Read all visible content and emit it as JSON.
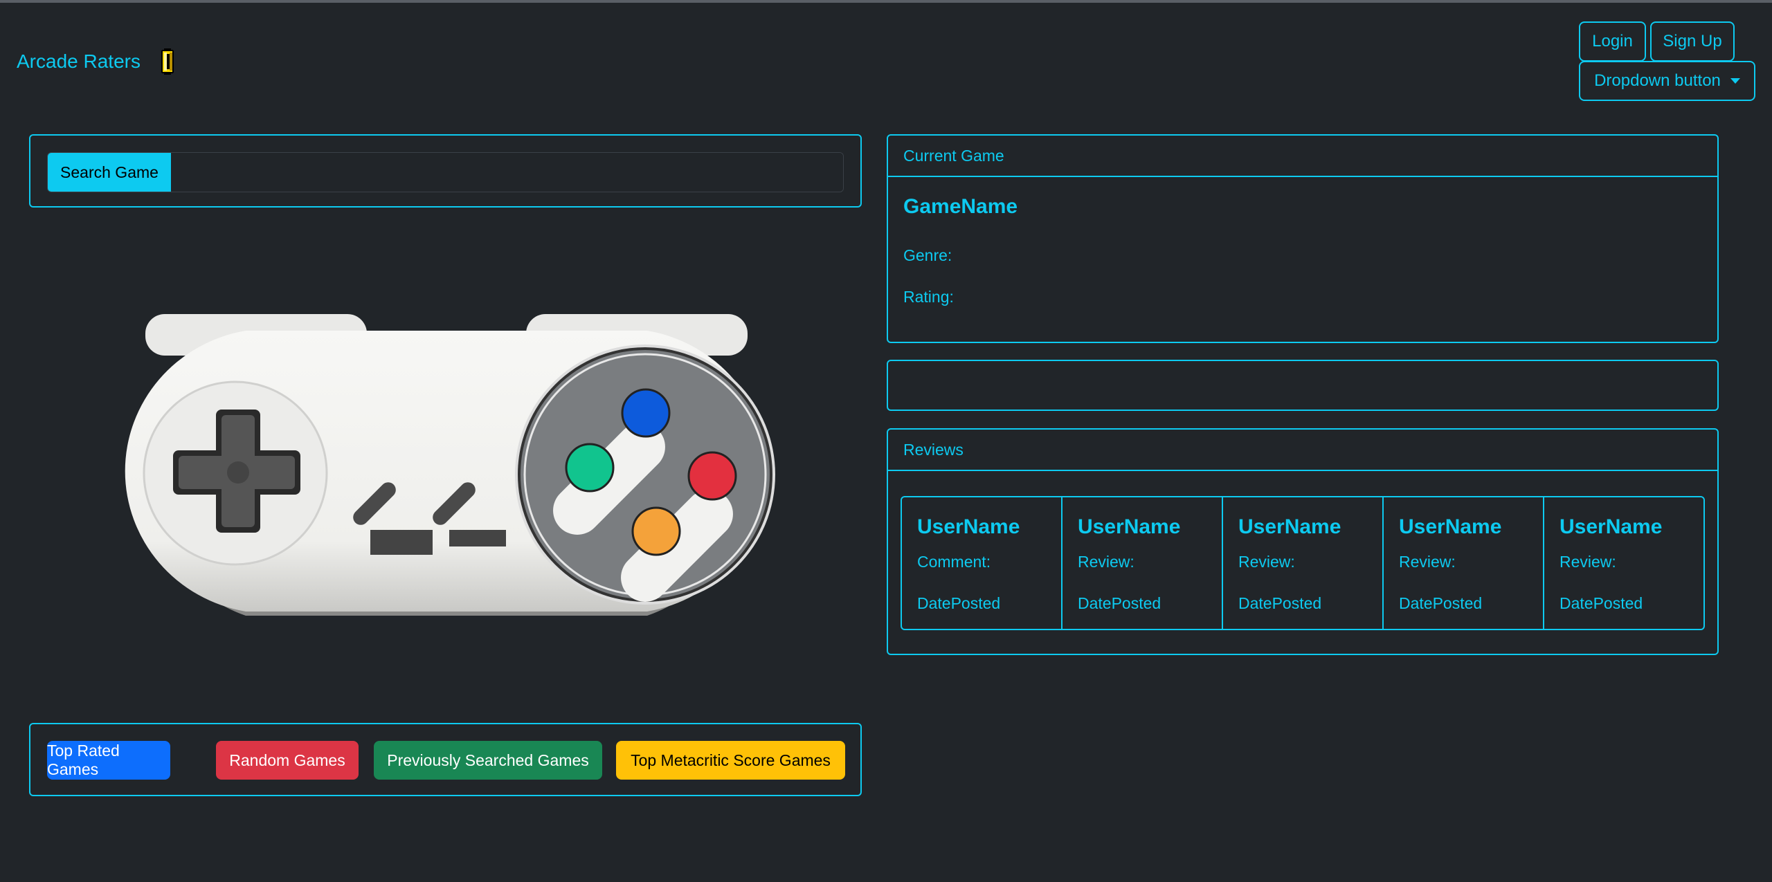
{
  "brand": {
    "title": "Arcade Raters",
    "icon": "coin-icon"
  },
  "nav": {
    "login": "Login",
    "signup": "Sign Up",
    "dropdown": "Dropdown button"
  },
  "search": {
    "button": "Search Game",
    "value": "",
    "placeholder": ""
  },
  "current_game": {
    "header": "Current Game",
    "name": "GameName",
    "genre_label": "Genre:",
    "rating_label": "Rating:"
  },
  "reviews": {
    "header": "Reviews",
    "items": [
      {
        "user": "UserName",
        "label": "Comment:",
        "date": "DatePosted"
      },
      {
        "user": "UserName",
        "label": "Review:",
        "date": "DatePosted"
      },
      {
        "user": "UserName",
        "label": "Review:",
        "date": "DatePosted"
      },
      {
        "user": "UserName",
        "label": "Review:",
        "date": "DatePosted"
      },
      {
        "user": "UserName",
        "label": "Review:",
        "date": "DatePosted"
      }
    ]
  },
  "actions": {
    "top_rated": "Top Rated Games",
    "random": "Random Games",
    "previous": "Previously Searched Games",
    "metacritic": "Top Metacritic Score Games"
  },
  "colors": {
    "accent": "#0dcaf0",
    "background": "#212529",
    "primary": "#0d6efd",
    "danger": "#dc3545",
    "success": "#198754",
    "warning": "#ffc107"
  },
  "illustration": "snes-controller-image"
}
